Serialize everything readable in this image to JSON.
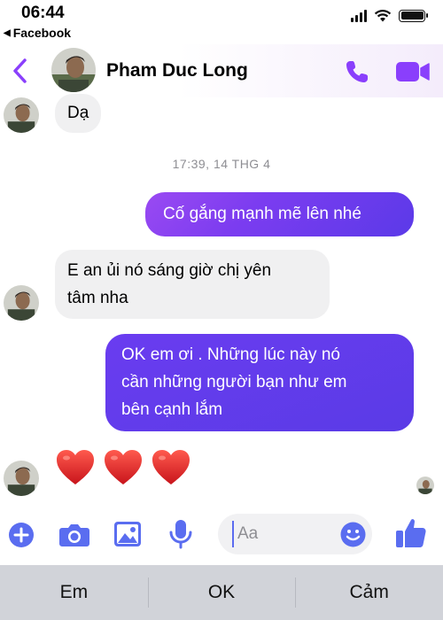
{
  "status_bar": {
    "time": "06:44",
    "back_app_label": "Facebook"
  },
  "header": {
    "contact_name": "Pham Duc Long"
  },
  "messages": [
    {
      "direction": "incoming",
      "text": "Dạ"
    },
    {
      "direction": "outgoing",
      "text": "Cố gắng mạnh mẽ lên nhé"
    },
    {
      "direction": "incoming",
      "lines": [
        "E an ủi nó sáng giờ chị yên",
        "tâm nha"
      ]
    },
    {
      "direction": "outgoing",
      "lines": [
        "OK em ơi . Những lúc này nó",
        "cần  những người bạn như em",
        "bên cạnh lắm"
      ]
    },
    {
      "direction": "incoming",
      "type": "emoji",
      "emoji_count": 3,
      "emoji": "red-heart"
    }
  ],
  "timestamp": "17:39, 14 THG 4",
  "composer": {
    "placeholder": "Aa"
  },
  "suggestions": [
    "Em",
    "OK",
    "Cảm"
  ],
  "colors": {
    "accent": "#8a3ffc",
    "outgoing_bubble_start": "#9a4af2",
    "outgoing_bubble_end": "#5b3ae8",
    "incoming_bubble": "#f0f0f1",
    "icon_blue": "#5a6df0",
    "heart_red": "#e0242b"
  },
  "icons": {
    "back": "chevron-left-icon",
    "call": "phone-icon",
    "video": "video-camera-icon",
    "add": "plus-circle-icon",
    "camera": "camera-icon",
    "gallery": "image-icon",
    "voice": "microphone-icon",
    "emoji": "smiley-icon",
    "like": "thumbs-up-icon"
  }
}
